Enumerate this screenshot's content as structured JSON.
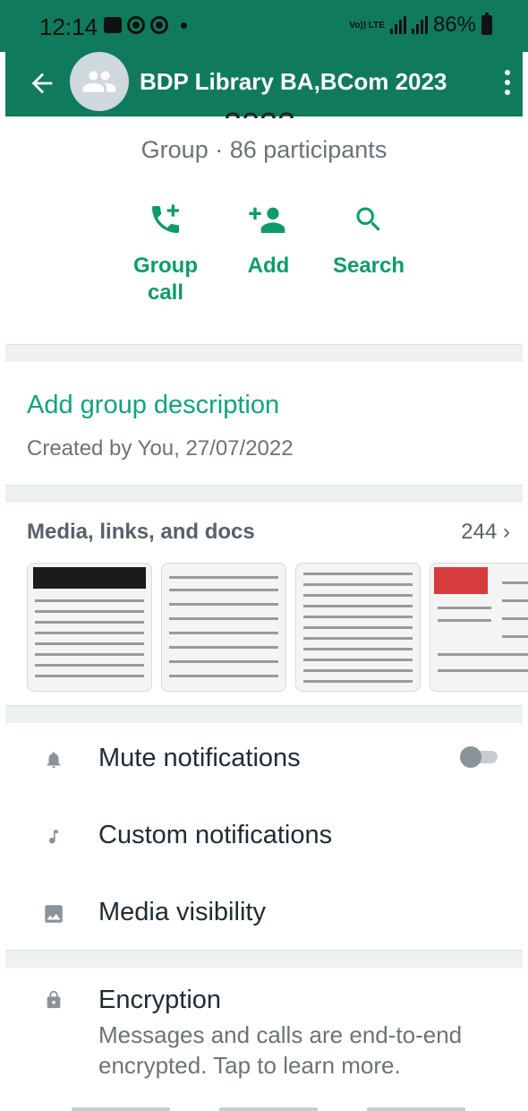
{
  "status_bar": {
    "time": "12:14",
    "volte": "Vo)) LTE",
    "battery": "86%"
  },
  "header": {
    "title": "BDP Library BA,BCom 2023",
    "title_fragment": "2023"
  },
  "group_info": {
    "subtitle": "Group · 86 participants"
  },
  "actions": [
    {
      "label": "Group\ncall",
      "icon": "add-call-icon"
    },
    {
      "label": "Add",
      "icon": "add-person-icon"
    },
    {
      "label": "Search",
      "icon": "search-icon"
    }
  ],
  "description": {
    "link": "Add group description",
    "created": "Created by You, 27/07/2022"
  },
  "media": {
    "heading": "Media, links, and docs",
    "count": "244",
    "thumbnails": 5
  },
  "settings": {
    "mute": {
      "label": "Mute notifications",
      "enabled": false
    },
    "custom": {
      "label": "Custom notifications"
    },
    "visibility": {
      "label": "Media visibility"
    },
    "encryption": {
      "title": "Encryption",
      "subtitle": "Messages and calls are end-to-end encrypted. Tap to learn more."
    }
  },
  "colors": {
    "primary": "#0f7a5c",
    "accent": "#0f9a6b",
    "link": "#12a37a"
  }
}
